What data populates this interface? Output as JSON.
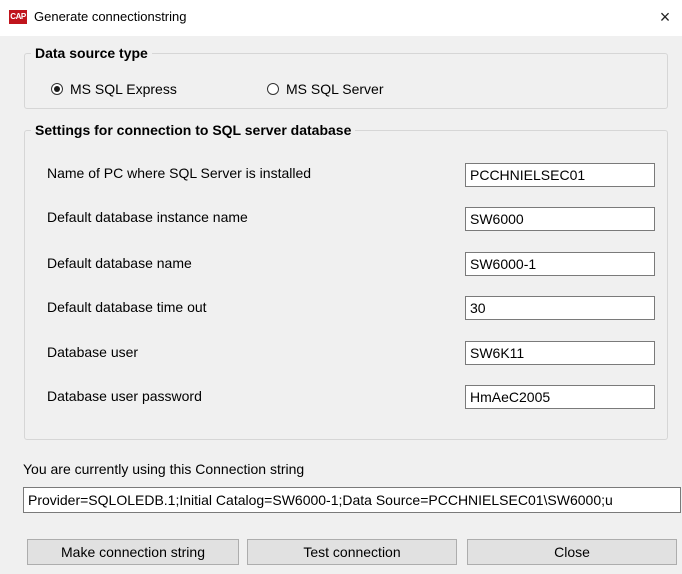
{
  "window": {
    "icon_text": "CAP",
    "title": "Generate connectionstring",
    "close_glyph": "×"
  },
  "data_source": {
    "legend": "Data source type",
    "options": [
      {
        "label": "MS SQL Express",
        "selected": true
      },
      {
        "label": "MS SQL Server",
        "selected": false
      }
    ]
  },
  "settings": {
    "legend": "Settings for connection to SQL server database",
    "fields": [
      {
        "label": "Name of PC where SQL Server is installed",
        "value": "PCCHNIELSEC01"
      },
      {
        "label": "Default database instance name",
        "value": "SW6000"
      },
      {
        "label": "Default database name",
        "value": "SW6000-1"
      },
      {
        "label": "Default database time out",
        "value": "30"
      },
      {
        "label": "Database user",
        "value": "SW6K11"
      },
      {
        "label": "Database user password",
        "value": "HmAeC2005"
      }
    ]
  },
  "connection": {
    "label": "You are currently using this Connection string",
    "value": "Provider=SQLOLEDB.1;Initial Catalog=SW6000-1;Data Source=PCCHNIELSEC01\\SW6000;u"
  },
  "buttons": {
    "make": "Make connection string",
    "test": "Test connection",
    "close": "Close"
  }
}
